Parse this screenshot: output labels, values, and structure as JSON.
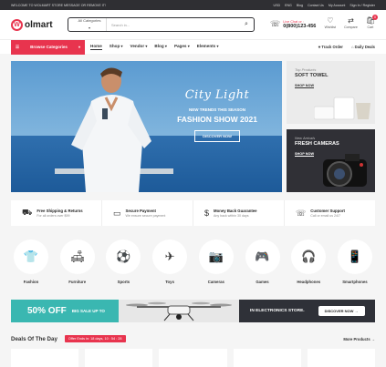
{
  "topbar": {
    "welcome": "WELCOME TO WOLMART STORE MESSAGE OR REMOVE IT!",
    "currency": "USD",
    "language": "ENG",
    "links": [
      "Blog",
      "Contact Us",
      "My Account",
      "Sign In / Register"
    ]
  },
  "header": {
    "logo": "olmart",
    "logo_mark": "W",
    "search_category": "All Categories",
    "search_placeholder": "Search in...",
    "contact_label": "Live Chat or :",
    "contact_phone": "0(800)123-456",
    "icons": [
      {
        "name": "Wishlist",
        "glyph": "♡"
      },
      {
        "name": "Compare",
        "glyph": "⇄"
      },
      {
        "name": "Cart",
        "glyph": "🛍"
      }
    ],
    "cart_count": "0"
  },
  "nav": {
    "browse": "Browse Categories",
    "links": [
      "Home",
      "Shop",
      "Vendor",
      "Blog",
      "Pages",
      "Elements"
    ],
    "track": "Track Order",
    "deals": "Daily Deals"
  },
  "hero": {
    "script": "City Light",
    "subtitle": "NEW TRENDS THIS SEASON",
    "title": "FASHION SHOW 2021",
    "button": "DISCOVER NOW"
  },
  "promos": [
    {
      "tag": "Top Products",
      "title": "SOFT TOWEL",
      "link": "SHOP NOW"
    },
    {
      "tag": "New Arrivals",
      "title": "FRESH CAMERAS",
      "link": "SHOP NOW"
    }
  ],
  "features": [
    {
      "title": "Free Shipping & Returns",
      "sub": "For all orders over $99",
      "icon": "⛟"
    },
    {
      "title": "Secure Payment",
      "sub": "We ensure secure payment",
      "icon": "▭"
    },
    {
      "title": "Money Back Guarantee",
      "sub": "Any back within 30 days",
      "icon": "$"
    },
    {
      "title": "Customer Support",
      "sub": "Call or email us 24/7",
      "icon": "☏"
    }
  ],
  "categories": [
    {
      "label": "Fashion",
      "icon": "👕"
    },
    {
      "label": "Furniture",
      "icon": "🛋"
    },
    {
      "label": "Sports",
      "icon": "⚽"
    },
    {
      "label": "Toys",
      "icon": "✈"
    },
    {
      "label": "Cameras",
      "icon": "📷"
    },
    {
      "label": "Games",
      "icon": "🎮"
    },
    {
      "label": "Headphones",
      "icon": "🎧"
    },
    {
      "label": "Smartphones",
      "icon": "📱"
    }
  ],
  "banner": {
    "percent": "50% OFF",
    "sale_line1": "BIG SALE UP TO",
    "sale_line2": "",
    "store": "IN ELECTRONICS STORE.",
    "button": "DISCOVER NOW"
  },
  "deals": {
    "title": "Deals Of The Day",
    "offer": "Offer Ends in: 18 days, 10 : 54 : 28",
    "more": "More Products →"
  },
  "colors": {
    "accent": "#e8344e",
    "dark": "#2f2f33",
    "teal": "#3ab7b1"
  }
}
